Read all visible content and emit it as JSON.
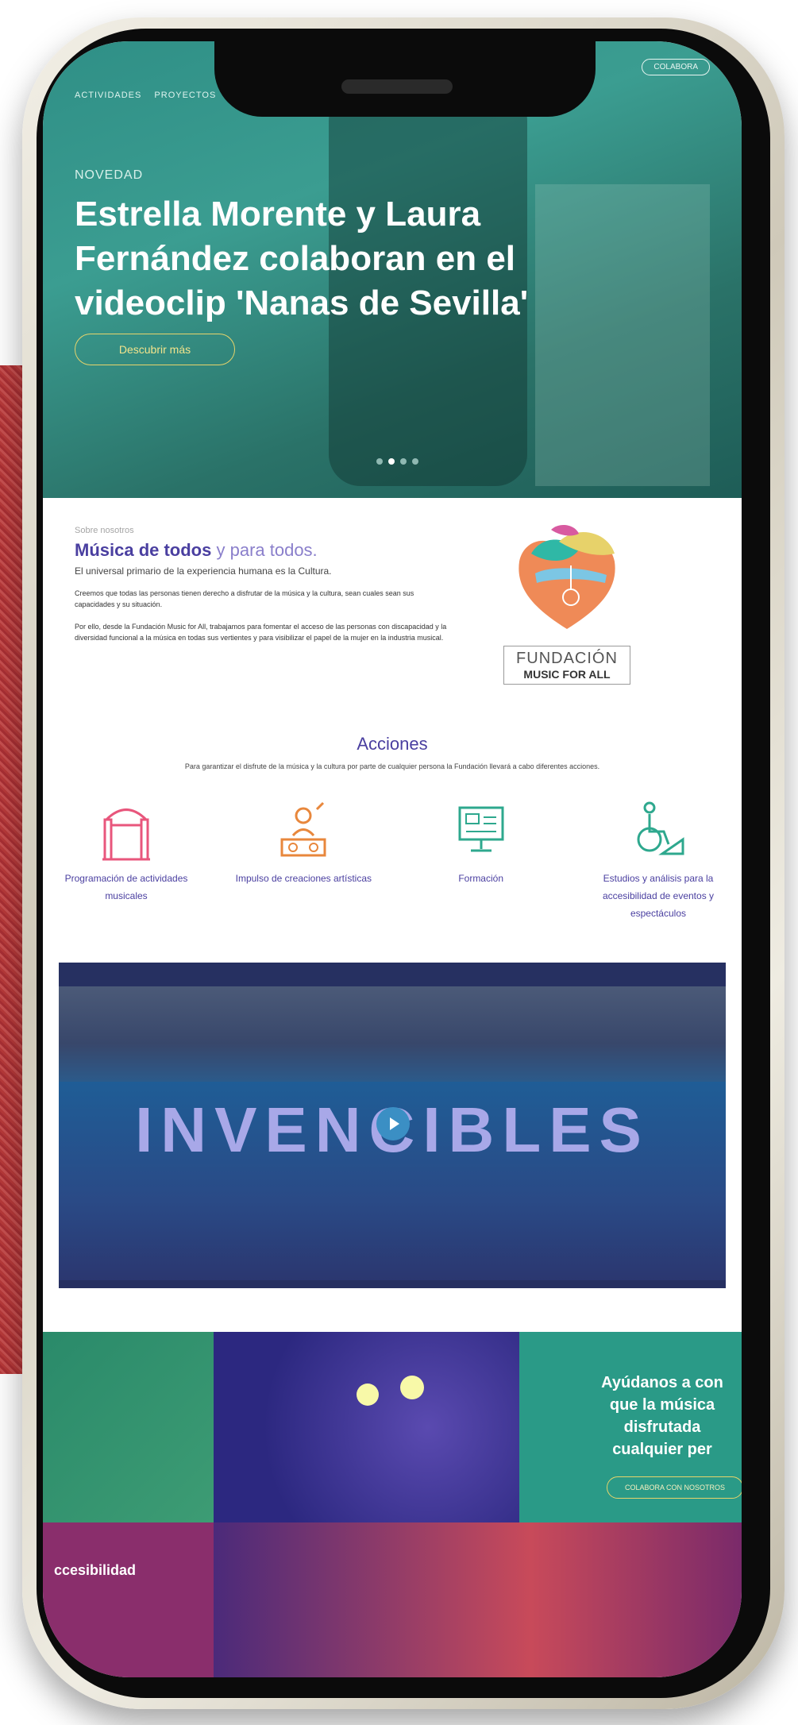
{
  "nav": {
    "items": [
      "ACTIVIDADES",
      "PROYECTOS"
    ],
    "collab_top": "COLABORA"
  },
  "hero": {
    "kicker": "NOVEDAD",
    "headline": "Estrella Morente y Laura Fernández colaboran en el videoclip 'Nanas de Sevilla'",
    "button": "Descubrir más",
    "slides_total": 4,
    "active_slide": 2
  },
  "intro": {
    "kicker": "Sobre nosotros",
    "title_bold": "Música de todos",
    "title_light": "y para todos.",
    "subtitle": "El universal primario de la experiencia humana es la Cultura.",
    "p1": "Creemos que todas las personas tienen derecho a disfrutar de la música y la cultura, sean cuales sean sus capacidades y su situación.",
    "p2": "Por ello, desde la Fundación Music for All, trabajamos para fomentar el acceso de las personas con discapacidad y la diversidad funcional a la música en todas sus vertientes y para visibilizar el papel de la mujer en la industria musical."
  },
  "logo": {
    "line1": "FUNDACIÓN",
    "line2": "MUSIC FOR ALL"
  },
  "acciones": {
    "title": "Acciones",
    "subtitle": "Para garantizar el disfrute de la música y la cultura por parte de cualquier persona la Fundación llevará a cabo diferentes acciones.",
    "items": [
      {
        "label": "Programación de actividades musicales",
        "icon": "stage-icon",
        "color": "#e8567c"
      },
      {
        "label": "Impulso de creaciones artísticas",
        "icon": "dj-icon",
        "color": "#e8873c"
      },
      {
        "label": "Formación",
        "icon": "monitor-icon",
        "color": "#2ea88e"
      },
      {
        "label": "Estudios y análisis para la accesibilidad de eventos y espectáculos",
        "icon": "wheelchair-icon",
        "color": "#2ea88e"
      }
    ]
  },
  "video": {
    "title": "INVENCIBLES"
  },
  "bottom": {
    "cta": "Ayúdanos a con\nque la música\ndisfrutada\ncualquier per",
    "cta_button": "COLABORA CON NOSOTROS",
    "access_label": "ccesibilidad"
  }
}
